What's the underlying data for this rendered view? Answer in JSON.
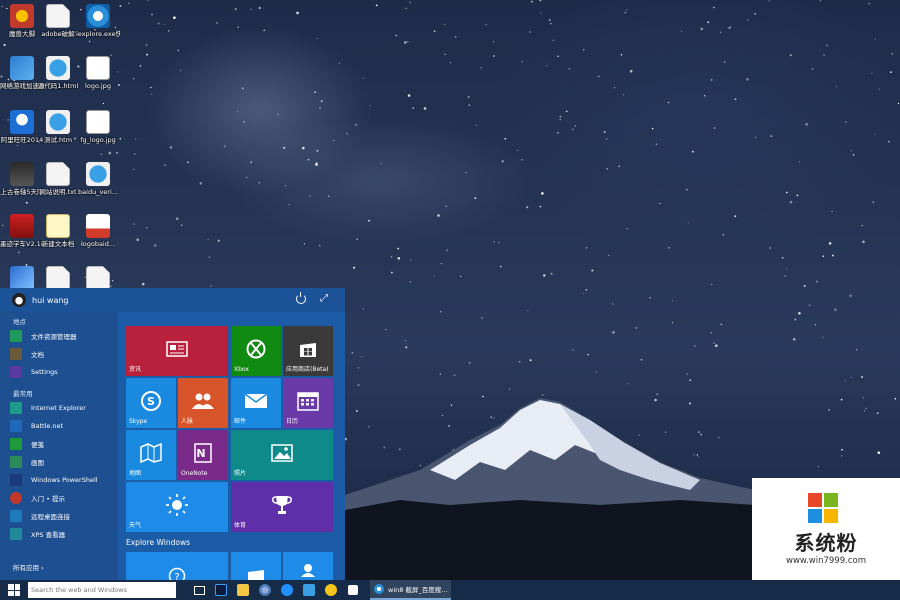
{
  "colors": {
    "start_left": "#1d4f91",
    "start_right": "#1c5ba6",
    "taskbar": "#152b47",
    "tile_red": "#b8203c",
    "tile_green": "#108a10",
    "tile_gray": "#3a3a3a",
    "tile_blue": "#1a8ae0",
    "tile_orange": "#d8542a",
    "tile_purple": "#6a3aa8",
    "tile_onenote": "#7a2a88",
    "tile_teal": "#0e8a8a",
    "tile_weather": "#1f8be8",
    "tile_sports": "#5e2fa8"
  },
  "desktop_icons": [
    {
      "label": "魔兽大脚",
      "icon": "game-icon"
    },
    {
      "label": "adobe破解",
      "icon": "document-icon"
    },
    {
      "label": "iexplore.exe快捷方式",
      "icon": "ie-icon"
    },
    {
      "label": "网络游戏加速器",
      "icon": "network-icon"
    },
    {
      "label": "源代码1.html",
      "icon": "html-icon"
    },
    {
      "label": "logo.jpg",
      "icon": "image-icon"
    },
    {
      "label": "阿里旺旺2014",
      "icon": "penguin-icon"
    },
    {
      "label": "测试.htm",
      "icon": "html-icon"
    },
    {
      "label": "fg_logo.jpg",
      "icon": "image-icon"
    },
    {
      "label": "上古卷轴5天际",
      "icon": "skyrim-icon"
    },
    {
      "label": "网站说明.txt",
      "icon": "document-icon"
    },
    {
      "label": "baidu_veri...",
      "icon": "html-icon"
    },
    {
      "label": "墨迹学车V2.1(乐享...",
      "icon": "car-icon"
    },
    {
      "label": "新建文本档",
      "icon": "text-icon"
    },
    {
      "label": "logobaid...",
      "icon": "baidu-icon"
    },
    {
      "label": "",
      "icon": "pen-icon"
    },
    {
      "label": "",
      "icon": "document-icon"
    },
    {
      "label": "",
      "icon": "document-icon"
    }
  ],
  "start_menu": {
    "user_name": "hui wang",
    "places_header": "地点",
    "places": [
      {
        "label": "文件资源管理器",
        "icon": "folder-icon"
      },
      {
        "label": "文档",
        "icon": "documents-icon"
      },
      {
        "label": "Settings",
        "icon": "gear-icon"
      }
    ],
    "most_used_header": "最常用",
    "most_used": [
      {
        "label": "Internet Explorer",
        "icon": "ie-icon"
      },
      {
        "label": "Battle.net",
        "icon": "battlenet-icon"
      },
      {
        "label": "便笺",
        "icon": "sticky-notes-icon"
      },
      {
        "label": "画图",
        "icon": "paint-icon"
      },
      {
        "label": "Windows PowerShell",
        "icon": "powershell-icon"
      },
      {
        "label": "入门 • 提示",
        "icon": "tips-icon"
      },
      {
        "label": "远程桌面连接",
        "icon": "remote-desktop-icon"
      },
      {
        "label": "XPS 查看器",
        "icon": "xps-icon"
      }
    ],
    "all_apps": "所有应用 ›",
    "tiles": [
      {
        "label": "资讯",
        "icon": "news-icon"
      },
      {
        "label": "Xbox",
        "icon": "xbox-icon"
      },
      {
        "label": "应用商店(Beta)",
        "icon": "store-icon"
      },
      {
        "label": "Skype",
        "icon": "skype-icon"
      },
      {
        "label": "人脉",
        "icon": "people-icon"
      },
      {
        "label": "邮件",
        "icon": "mail-icon"
      },
      {
        "label": "日历",
        "icon": "calendar-icon"
      },
      {
        "label": "地图",
        "icon": "maps-icon"
      },
      {
        "label": "OneNote",
        "icon": "onenote-icon"
      },
      {
        "label": "照片",
        "icon": "photos-icon"
      },
      {
        "label": "天气",
        "icon": "weather-icon"
      },
      {
        "label": "体育",
        "icon": "trophy-icon"
      }
    ],
    "explore_label": "Explore Windows"
  },
  "taskbar": {
    "search_placeholder": "Search the web and Windows",
    "pinned": [
      "task-view-icon",
      "photoshop-icon",
      "file-explorer-icon",
      "globe-icon",
      "qq-icon",
      "penguin-icon",
      "smiley-icon",
      "store-icon"
    ],
    "active_task": "win8 截屏_百度搜..."
  },
  "watermark": {
    "title": "系统粉",
    "url": "www.win7999.com"
  }
}
